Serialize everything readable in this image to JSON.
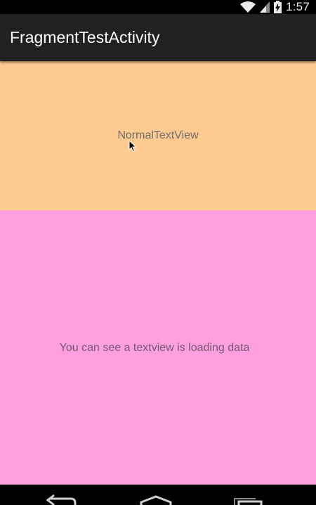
{
  "status_bar": {
    "time": "1:57",
    "icons": [
      "wifi-icon",
      "cell-signal-icon",
      "battery-charging-icon"
    ]
  },
  "action_bar": {
    "title": "FragmentTestActivity"
  },
  "fragments": {
    "top": {
      "text": "NormalTextView",
      "background": "#ffca8f"
    },
    "bottom": {
      "text": "You can see a textview is loading data",
      "background": "#ff9fdf"
    }
  },
  "nav_bar": {
    "buttons": [
      "back-icon",
      "home-icon",
      "recents-icon"
    ]
  },
  "colors": {
    "action_bar": "#212121",
    "status_bar": "#000000",
    "nav_bar": "#000000"
  }
}
